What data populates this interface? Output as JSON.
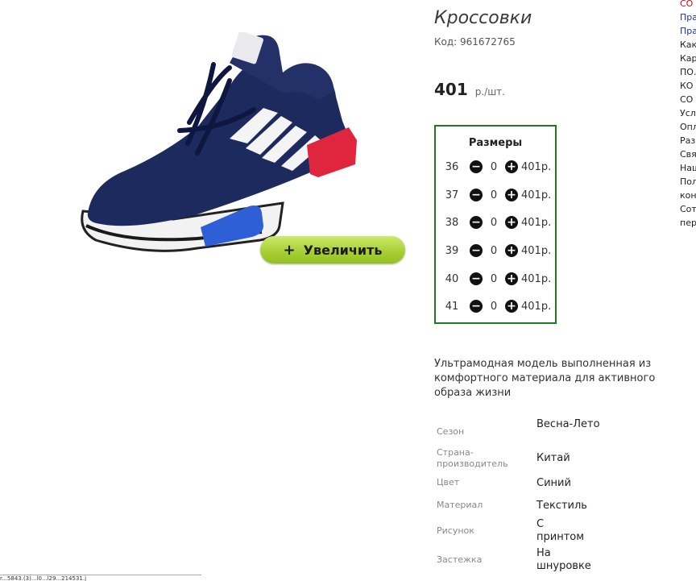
{
  "product": {
    "title": "Кроссовки",
    "code": "Код: 961672765",
    "price": "401",
    "price_unit": "р./шт.",
    "zoom_button": "Увеличить",
    "zoom_plus": "+",
    "description": "Ультрамодная модель выполненная из комфортного материала для активного образа жизни"
  },
  "sizes": {
    "title": "Размеры",
    "minus": "−",
    "plus": "+",
    "rows": [
      {
        "size": "36",
        "qty": "0",
        "price": "401р."
      },
      {
        "size": "37",
        "qty": "0",
        "price": "401р."
      },
      {
        "size": "38",
        "qty": "0",
        "price": "401р."
      },
      {
        "size": "39",
        "qty": "0",
        "price": "401р."
      },
      {
        "size": "40",
        "qty": "0",
        "price": "401р."
      },
      {
        "size": "41",
        "qty": "0",
        "price": "401р."
      }
    ]
  },
  "attributes": [
    {
      "label": "Сезон",
      "value": "Весна-Лето"
    },
    {
      "label": "Страна-производитель",
      "value": "Китай"
    },
    {
      "label": "Цвет",
      "value": "Синий"
    },
    {
      "label": "Материал",
      "value": "Текстиль"
    },
    {
      "label": "Рисунок",
      "value": "С принтом"
    },
    {
      "label": "Застежка",
      "value": "На шнуровке"
    }
  ],
  "side_menu": [
    "СО",
    "Пра",
    "Пра",
    "Как",
    "Кар",
    "ПО.",
    "КО",
    "СО",
    "Усл",
    "Опл",
    "Раз",
    "Свя",
    "Наш",
    "Пол",
    "кон",
    "Сот",
    "пер"
  ],
  "status_text": "r...5843.(3)...l0...l29...214531.j",
  "colors": {
    "sizes_border": "#1f7a1f",
    "zoom_button": "#a9d037",
    "menu_red": "#c41010",
    "menu_blue": "#1a2fc0"
  }
}
